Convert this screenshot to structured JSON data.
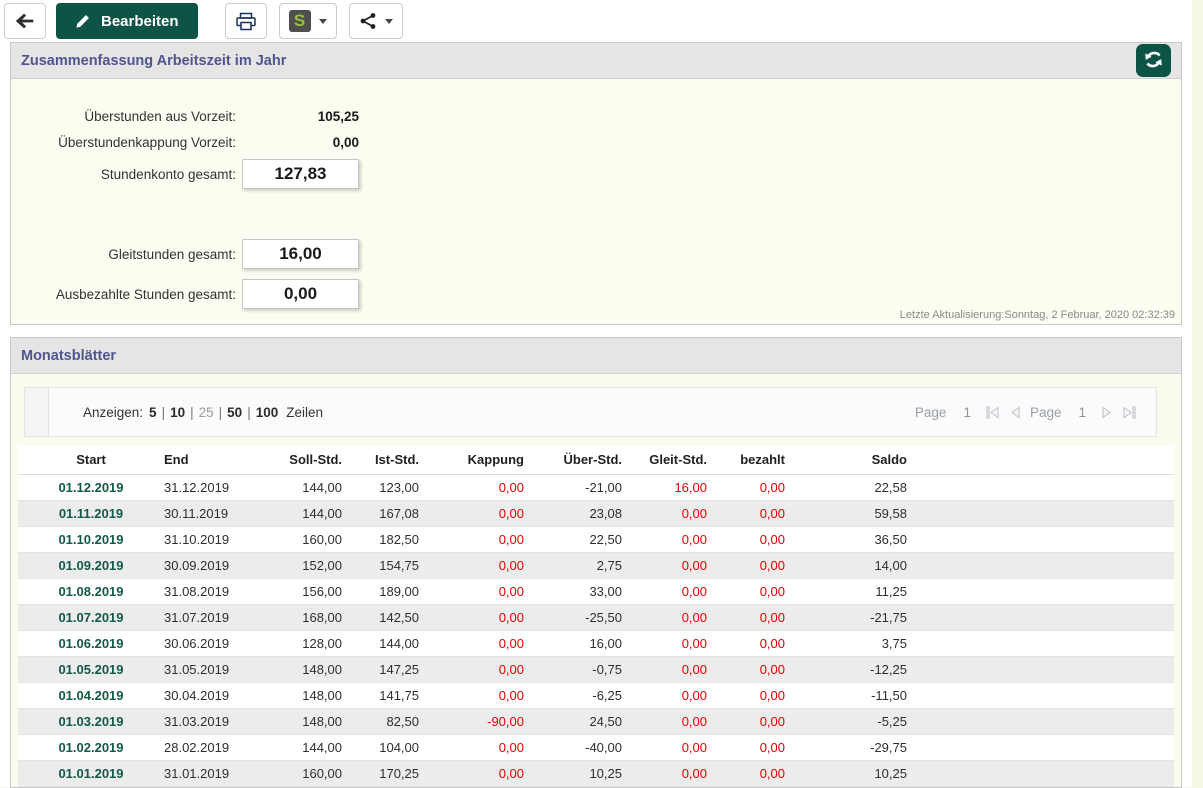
{
  "toolbar": {
    "edit_label": "Bearbeiten"
  },
  "icons": {
    "back": "arrow-left",
    "edit": "pencil",
    "print": "printer",
    "s_menu": "s-logo",
    "s_logo_letter": "S",
    "dropdown": "chevron-down",
    "share": "share-nodes",
    "refresh": "arrows-rotate",
    "pagination": [
      "first-page",
      "prev-page",
      "next-page",
      "last-page"
    ]
  },
  "colors": {
    "accent_green": "#0d5447",
    "header_purple": "#50558f",
    "negative_red": "#e60000",
    "s_logo_green": "#9bc23a",
    "panel_cream": "#fcfcf0"
  },
  "summary": {
    "title": "Zusammenfassung Arbeitszeit im Jahr",
    "fields": [
      {
        "label": "Überstunden aus Vorzeit:",
        "value": "105,25"
      },
      {
        "label": "Überstundenkappung Vorzeit:",
        "value": "0,00"
      },
      {
        "label": "Stundenkonto gesamt:",
        "value": "127,83"
      },
      {
        "label": "Gleitstunden gesamt:",
        "value": "16,00"
      },
      {
        "label": "Ausbezahlte Stunden gesamt:",
        "value": "0,00"
      }
    ],
    "last_update": "Letzte Aktualisierung:Sonntag, 2 Februar, 2020 02:32:39"
  },
  "months": {
    "title": "Monatsblätter",
    "display": {
      "prefix": "Anzeigen:",
      "options": [
        "5",
        "10",
        "25",
        "50",
        "100"
      ],
      "active": "25",
      "separator": "|",
      "suffix": "Zeilen"
    },
    "pagination": {
      "label": "Page",
      "page": "1"
    },
    "columns": [
      "Start",
      "End",
      "Soll-Std.",
      "Ist-Std.",
      "Kappung",
      "Über-Std.",
      "Gleit-Std.",
      "bezahlt",
      "Saldo"
    ],
    "rows": [
      {
        "start": "01.12.2019",
        "end": "31.12.2019",
        "soll": "144,00",
        "ist": "123,00",
        "kappung": "0,00",
        "ueber": "-21,00",
        "gleit": "16,00",
        "bezahlt": "0,00",
        "saldo": "22,58"
      },
      {
        "start": "01.11.2019",
        "end": "30.11.2019",
        "soll": "144,00",
        "ist": "167,08",
        "kappung": "0,00",
        "ueber": "23,08",
        "gleit": "0,00",
        "bezahlt": "0,00",
        "saldo": "59,58"
      },
      {
        "start": "01.10.2019",
        "end": "31.10.2019",
        "soll": "160,00",
        "ist": "182,50",
        "kappung": "0,00",
        "ueber": "22,50",
        "gleit": "0,00",
        "bezahlt": "0,00",
        "saldo": "36,50"
      },
      {
        "start": "01.09.2019",
        "end": "30.09.2019",
        "soll": "152,00",
        "ist": "154,75",
        "kappung": "0,00",
        "ueber": "2,75",
        "gleit": "0,00",
        "bezahlt": "0,00",
        "saldo": "14,00"
      },
      {
        "start": "01.08.2019",
        "end": "31.08.2019",
        "soll": "156,00",
        "ist": "189,00",
        "kappung": "0,00",
        "ueber": "33,00",
        "gleit": "0,00",
        "bezahlt": "0,00",
        "saldo": "11,25"
      },
      {
        "start": "01.07.2019",
        "end": "31.07.2019",
        "soll": "168,00",
        "ist": "142,50",
        "kappung": "0,00",
        "ueber": "-25,50",
        "gleit": "0,00",
        "bezahlt": "0,00",
        "saldo": "-21,75"
      },
      {
        "start": "01.06.2019",
        "end": "30.06.2019",
        "soll": "128,00",
        "ist": "144,00",
        "kappung": "0,00",
        "ueber": "16,00",
        "gleit": "0,00",
        "bezahlt": "0,00",
        "saldo": "3,75"
      },
      {
        "start": "01.05.2019",
        "end": "31.05.2019",
        "soll": "148,00",
        "ist": "147,25",
        "kappung": "0,00",
        "ueber": "-0,75",
        "gleit": "0,00",
        "bezahlt": "0,00",
        "saldo": "-12,25"
      },
      {
        "start": "01.04.2019",
        "end": "30.04.2019",
        "soll": "148,00",
        "ist": "141,75",
        "kappung": "0,00",
        "ueber": "-6,25",
        "gleit": "0,00",
        "bezahlt": "0,00",
        "saldo": "-11,50"
      },
      {
        "start": "01.03.2019",
        "end": "31.03.2019",
        "soll": "148,00",
        "ist": "82,50",
        "kappung": "-90,00",
        "ueber": "24,50",
        "gleit": "0,00",
        "bezahlt": "0,00",
        "saldo": "-5,25"
      },
      {
        "start": "01.02.2019",
        "end": "28.02.2019",
        "soll": "144,00",
        "ist": "104,00",
        "kappung": "0,00",
        "ueber": "-40,00",
        "gleit": "0,00",
        "bezahlt": "0,00",
        "saldo": "-29,75"
      },
      {
        "start": "01.01.2019",
        "end": "31.01.2019",
        "soll": "160,00",
        "ist": "170,25",
        "kappung": "0,00",
        "ueber": "10,25",
        "gleit": "0,00",
        "bezahlt": "0,00",
        "saldo": "10,25"
      }
    ]
  }
}
